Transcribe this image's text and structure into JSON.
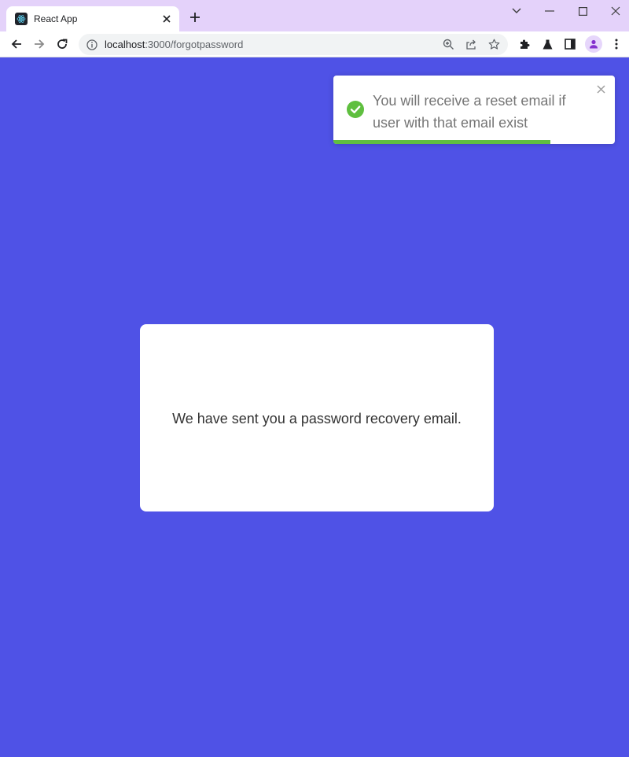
{
  "browser": {
    "tab_title": "React App",
    "url_host": "localhost",
    "url_path": ":3000/forgotpassword",
    "icons": {
      "favicon": "react-logo-icon",
      "tab_close": "close-icon",
      "new_tab": "plus-icon",
      "tab_search": "chevron-down-icon",
      "minimize": "minimize-icon",
      "maximize": "maximize-icon",
      "close_window": "close-icon",
      "back": "arrow-left-icon",
      "forward": "arrow-right-icon",
      "reload": "reload-icon",
      "site_info": "info-icon",
      "zoom": "zoom-icon",
      "share": "share-icon",
      "bookmark": "star-icon",
      "extensions": "puzzle-icon",
      "labs": "flask-icon",
      "side_panel": "side-panel-icon",
      "profile": "avatar-icon",
      "menu": "kebab-menu-icon"
    },
    "colors": {
      "titlebar": "#e4d2fa",
      "toolbar": "#ffffff",
      "omnibox": "#f1f3f4"
    }
  },
  "toast": {
    "message": "You will receive a reset email if user with that email exist",
    "type": "success",
    "icon": "check-circle-icon",
    "close_icon": "close-icon",
    "progress": 0.77,
    "colors": {
      "success": "#5fbf3f",
      "text": "#757575"
    }
  },
  "page": {
    "background": "#4f52e6",
    "card_message": "We have sent you a password recovery email."
  }
}
